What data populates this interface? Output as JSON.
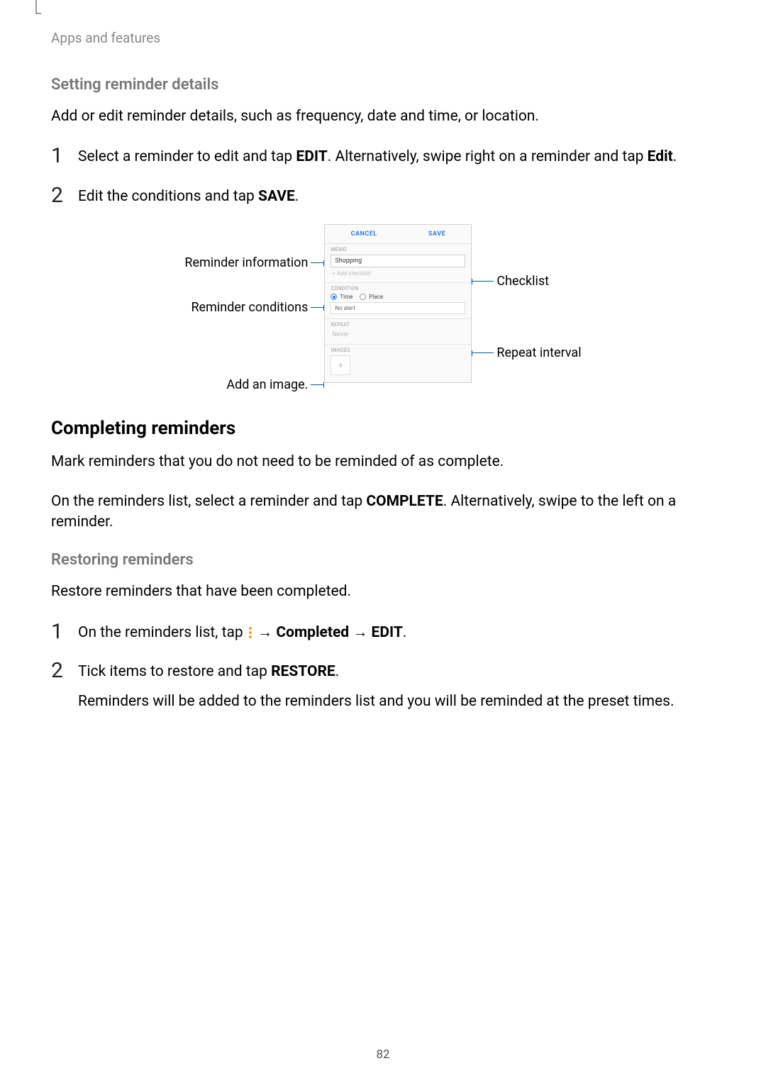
{
  "breadcrumb": "Apps and features",
  "section1": {
    "heading": "Setting reminder details",
    "intro": "Add or edit reminder details, such as frequency, date and time, or location.",
    "step1_pre": "Select a reminder to edit and tap ",
    "step1_bold1": "EDIT",
    "step1_mid": ". Alternatively, swipe right on a reminder and tap ",
    "step1_bold2": "Edit",
    "step1_post": ".",
    "step2_pre": "Edit the conditions and tap ",
    "step2_bold": "SAVE",
    "step2_post": "."
  },
  "figure": {
    "left_label1": "Reminder information",
    "left_label2": "Reminder conditions",
    "left_label3": "Add an image.",
    "right_label1": "Checklist",
    "right_label2": "Repeat interval"
  },
  "phone": {
    "cancel": "CANCEL",
    "save": "SAVE",
    "memo_label": "MEMO",
    "memo_value": "Shopping",
    "add_checklist": "+  Add checklist",
    "condition_label": "CONDITION",
    "radio_time": "Time",
    "radio_place": "Place",
    "no_alert": "No alert",
    "repeat_label": "REPEAT",
    "never": "Never",
    "images_label": "IMAGES",
    "plus": "+"
  },
  "section2": {
    "heading": "Completing reminders",
    "p1": "Mark reminders that you do not need to be reminded of as complete.",
    "p2_pre": "On the reminders list, select a reminder and tap ",
    "p2_bold": "COMPLETE",
    "p2_post": ". Alternatively, swipe to the left on a reminder."
  },
  "section3": {
    "heading": "Restoring reminders",
    "intro": "Restore reminders that have been completed.",
    "step1_pre": "On the reminders list, tap ",
    "step1_arrow1": " → ",
    "step1_bold1": "Completed",
    "step1_arrow2": " → ",
    "step1_bold2": "EDIT",
    "step1_post": ".",
    "step2_pre": "Tick items to restore and tap ",
    "step2_bold": "RESTORE",
    "step2_post": ".",
    "step2_para2": "Reminders will be added to the reminders list and you will be reminded at the preset times."
  },
  "page_number": "82"
}
